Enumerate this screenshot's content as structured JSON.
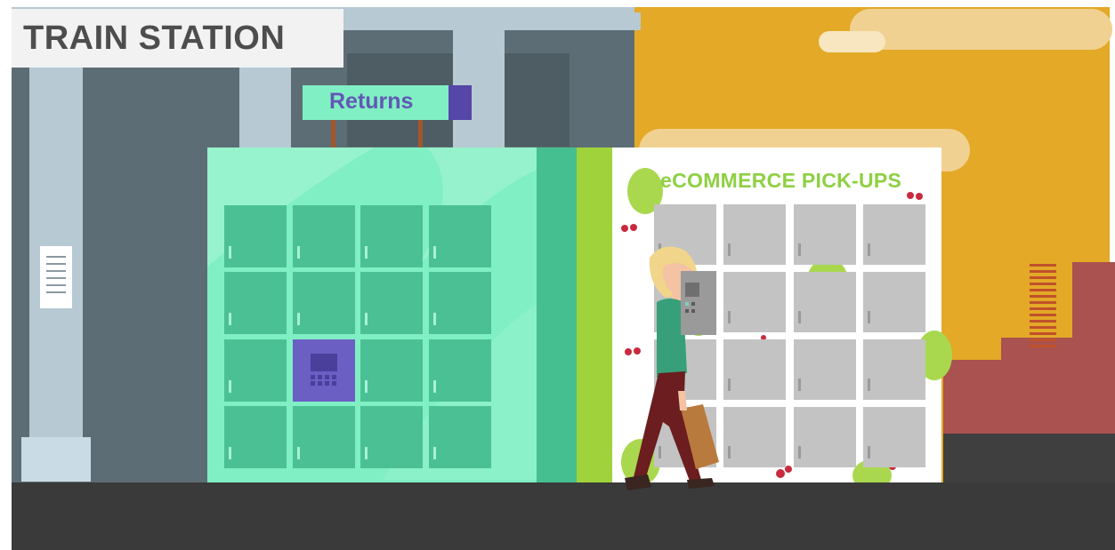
{
  "scene": {
    "title": "TRAIN STATION",
    "returns_sign": "Returns",
    "ecommerce_sign": "eCOMMERCE PICK-UPS"
  },
  "colors": {
    "sky": "#e3a927",
    "station_wall": "#5d6d75",
    "pillar": "#b7c9d3",
    "returns_locker": "#80efc3",
    "returns_door": "#4bc094",
    "keypad_locker": "#6c5fc4",
    "ecommerce_panel": "#ffffff",
    "ecommerce_door": "#c3c3c3",
    "lime_stripe": "#9fd23b",
    "pavement": "#3a3a3a",
    "brick_building": "#a9524f"
  }
}
